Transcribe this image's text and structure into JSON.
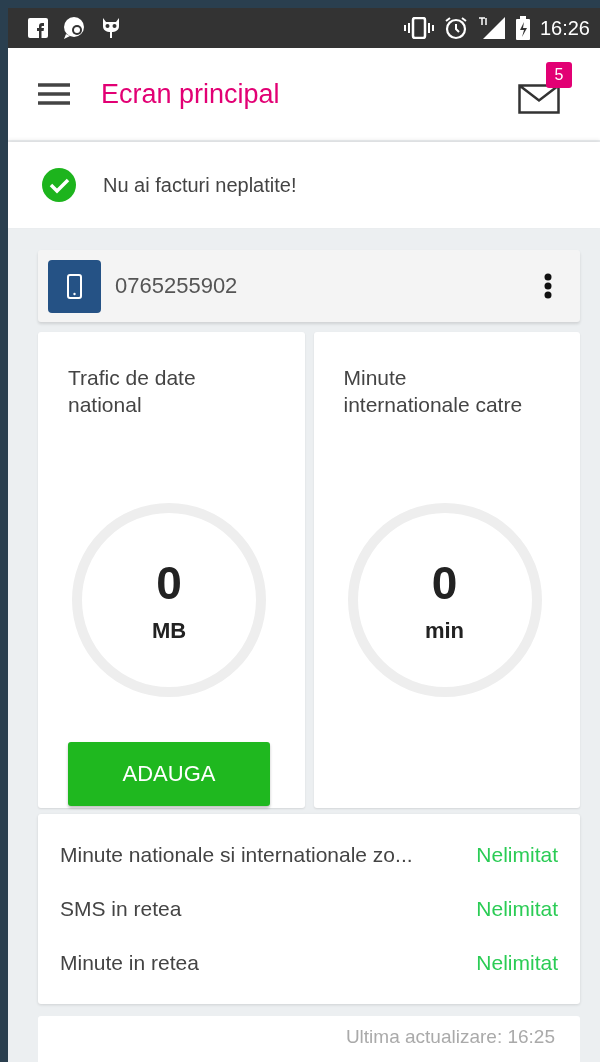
{
  "status_bar": {
    "time": "16:26"
  },
  "app_bar": {
    "title": "Ecran principal",
    "unread_count": "5"
  },
  "notice": {
    "text": "Nu ai facturi neplatite!"
  },
  "line": {
    "number": "0765255902"
  },
  "usage_cards": [
    {
      "title_lines": [
        "Trafic de date",
        "national"
      ],
      "value": "0",
      "unit": "MB",
      "button": "ADAUGA"
    },
    {
      "title_lines": [
        "Minute",
        "internationale catre"
      ],
      "value": "0",
      "unit": "min"
    }
  ],
  "allowances": [
    {
      "name": "Minute nationale si internationale zo...",
      "value": "Nelimitat"
    },
    {
      "name": "SMS in retea",
      "value": "Nelimitat"
    },
    {
      "name": "Minute in retea",
      "value": "Nelimitat"
    }
  ],
  "last_update": "Ultima actualizare: 16:25"
}
